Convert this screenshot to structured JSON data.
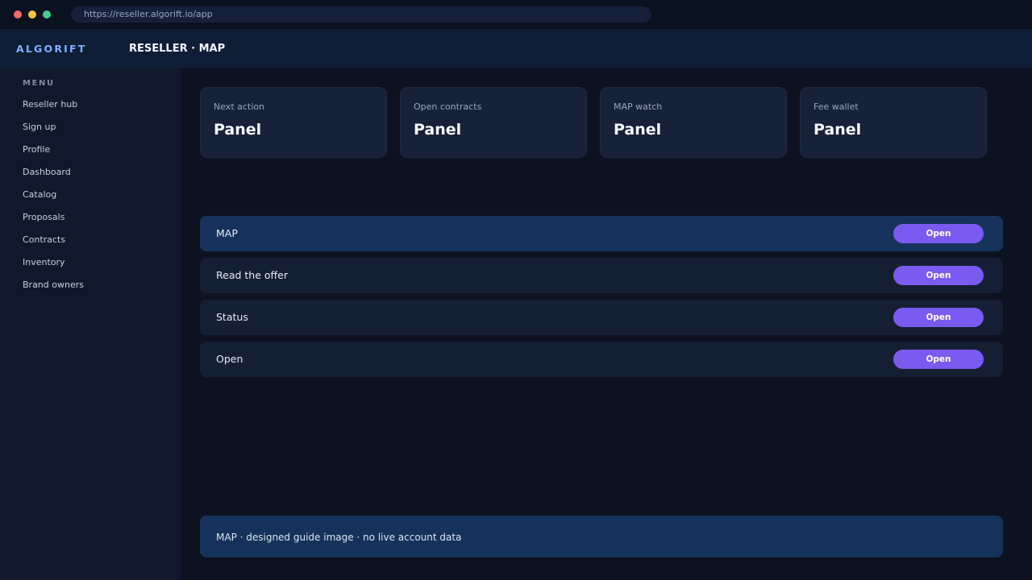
{
  "browser": {
    "url": "https://reseller.algorift.io/app"
  },
  "header": {
    "brand": "ALGORIFT",
    "title": "RESELLER · MAP"
  },
  "sidebar": {
    "section_title": "MENU",
    "items": [
      {
        "label": "Reseller hub"
      },
      {
        "label": "Sign up"
      },
      {
        "label": "Profile"
      },
      {
        "label": "Dashboard"
      },
      {
        "label": "Catalog"
      },
      {
        "label": "Proposals"
      },
      {
        "label": "Contracts"
      },
      {
        "label": "Inventory"
      },
      {
        "label": "Brand owners"
      }
    ]
  },
  "cards": [
    {
      "label": "Next action",
      "value": "Panel"
    },
    {
      "label": "Open contracts",
      "value": "Panel"
    },
    {
      "label": "MAP watch",
      "value": "Panel"
    },
    {
      "label": "Fee wallet",
      "value": "Panel"
    }
  ],
  "rows": [
    {
      "label": "MAP",
      "button": "Open",
      "active": true
    },
    {
      "label": "Read the offer",
      "button": "Open",
      "active": false
    },
    {
      "label": "Status",
      "button": "Open",
      "active": false
    },
    {
      "label": "Open",
      "button": "Open",
      "active": false
    }
  ],
  "footer": {
    "note": "MAP · designed guide image · no live account data"
  },
  "colors": {
    "accent": "#7a5af0",
    "brand": "#7db0ff",
    "active_row": "#17335c",
    "background": "#0c1220"
  }
}
